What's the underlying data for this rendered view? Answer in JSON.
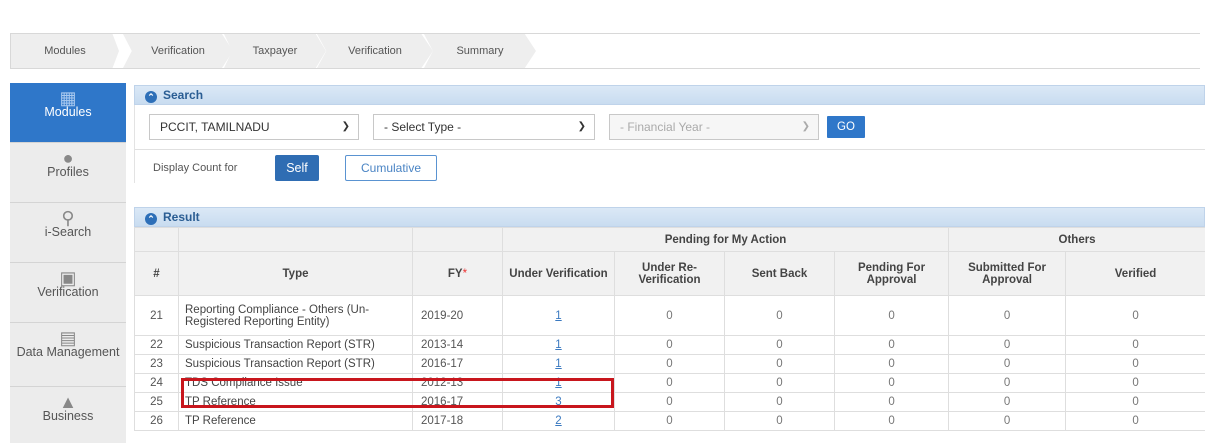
{
  "breadcrumb": [
    "Modules",
    "Verification",
    "Taxpayer",
    "Verification",
    "Summary"
  ],
  "nav": [
    {
      "label": "Modules",
      "icon": "modules-icon",
      "active": true
    },
    {
      "label": "Profiles",
      "icon": "profile-icon"
    },
    {
      "label": "i-Search",
      "icon": "search-icon"
    },
    {
      "label": "Verification",
      "icon": "verification-icon"
    },
    {
      "label": "Data Management",
      "icon": "data-icon"
    },
    {
      "label": "Business",
      "icon": "business-icon"
    }
  ],
  "search": {
    "title": "Search",
    "office": "PCCIT, TAMILNADU",
    "type_placeholder": "- Select Type -",
    "fy_placeholder": "- Financial Year -",
    "go": "GO",
    "display_label": "Display Count for",
    "self": "Self",
    "cumulative": "Cumulative"
  },
  "result": {
    "title": "Result",
    "group_pending": "Pending for My Action",
    "group_others": "Others",
    "headers": {
      "num": "#",
      "type": "Type",
      "fy": "FY",
      "under_verification": "Under Verification",
      "under_reverification": "Under Re-Verification",
      "sent_back": "Sent Back",
      "pending_approval": "Pending For Approval",
      "submitted_approval": "Submitted For Approval",
      "verified": "Verified"
    },
    "rows": [
      {
        "n": "21",
        "type": "Reporting Compliance - Others (Un-Registered Reporting Entity)",
        "fy": "2019-20",
        "uv": "1",
        "urv": "0",
        "sb": "0",
        "pa": "0",
        "sa": "0",
        "v": "0"
      },
      {
        "n": "22",
        "type": "Suspicious Transaction Report (STR)",
        "fy": "2013-14",
        "uv": "1",
        "urv": "0",
        "sb": "0",
        "pa": "0",
        "sa": "0",
        "v": "0"
      },
      {
        "n": "23",
        "type": "Suspicious Transaction Report (STR)",
        "fy": "2016-17",
        "uv": "1",
        "urv": "0",
        "sb": "0",
        "pa": "0",
        "sa": "0",
        "v": "0"
      },
      {
        "n": "24",
        "type": "TDS Compliance Issue",
        "fy": "2012-13",
        "uv": "1",
        "urv": "0",
        "sb": "0",
        "pa": "0",
        "sa": "0",
        "v": "0"
      },
      {
        "n": "25",
        "type": "TP Reference",
        "fy": "2016-17",
        "uv": "3",
        "urv": "0",
        "sb": "0",
        "pa": "0",
        "sa": "0",
        "v": "0"
      },
      {
        "n": "26",
        "type": "TP Reference",
        "fy": "2017-18",
        "uv": "2",
        "urv": "0",
        "sb": "0",
        "pa": "0",
        "sa": "0",
        "v": "0"
      }
    ]
  }
}
